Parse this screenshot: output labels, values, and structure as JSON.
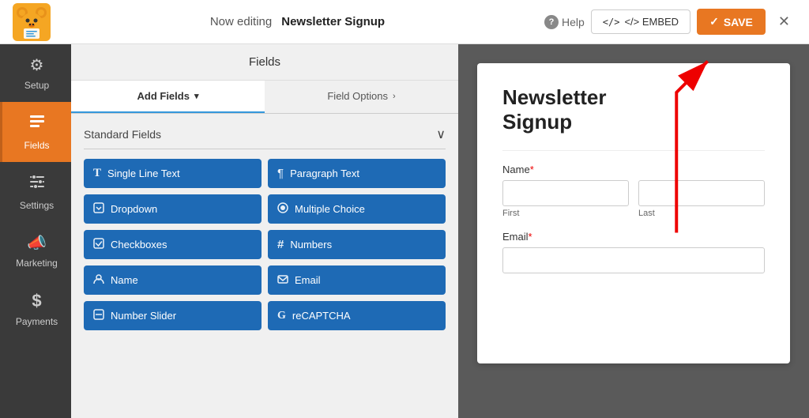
{
  "topbar": {
    "editing_prefix": "Now editing",
    "form_name": "Newsletter Signup",
    "help_label": "Help",
    "embed_label": "</> EMBED",
    "save_label": "✓ SAVE",
    "close_label": "✕"
  },
  "sidebar": {
    "items": [
      {
        "id": "setup",
        "label": "Setup",
        "icon": "⚙"
      },
      {
        "id": "fields",
        "label": "Fields",
        "icon": "▤",
        "active": true
      },
      {
        "id": "settings",
        "label": "Settings",
        "icon": "⚙"
      },
      {
        "id": "marketing",
        "label": "Marketing",
        "icon": "📢"
      },
      {
        "id": "payments",
        "label": "Payments",
        "icon": "$"
      }
    ]
  },
  "fields_panel": {
    "header": "Fields",
    "tabs": [
      {
        "id": "add-fields",
        "label": "Add Fields",
        "active": true,
        "has_arrow": true
      },
      {
        "id": "field-options",
        "label": "Field Options",
        "active": false,
        "has_arrow": true
      }
    ],
    "standard_fields": {
      "section_title": "Standard Fields",
      "buttons": [
        {
          "id": "single-line-text",
          "label": "Single Line Text",
          "icon": "T"
        },
        {
          "id": "paragraph-text",
          "label": "Paragraph Text",
          "icon": "¶"
        },
        {
          "id": "dropdown",
          "label": "Dropdown",
          "icon": "⊟"
        },
        {
          "id": "multiple-choice",
          "label": "Multiple Choice",
          "icon": "⊙"
        },
        {
          "id": "checkboxes",
          "label": "Checkboxes",
          "icon": "☑"
        },
        {
          "id": "numbers",
          "label": "Numbers",
          "icon": "#"
        },
        {
          "id": "name",
          "label": "Name",
          "icon": "👤"
        },
        {
          "id": "email",
          "label": "Email",
          "icon": "✉"
        },
        {
          "id": "number-slider",
          "label": "Number Slider",
          "icon": "⊟"
        },
        {
          "id": "recaptcha",
          "label": "reCAPTCHA",
          "icon": "G"
        }
      ]
    }
  },
  "form_preview": {
    "title_line1": "Newsletter",
    "title_line2": "Signup",
    "fields": [
      {
        "id": "name",
        "label": "Name",
        "required": true,
        "type": "name",
        "subfields": [
          {
            "placeholder": "",
            "sublabel": "First"
          },
          {
            "placeholder": "",
            "sublabel": "Last"
          }
        ]
      },
      {
        "id": "email",
        "label": "Email",
        "required": true,
        "type": "text"
      }
    ]
  },
  "icons": {
    "setup": "⚙",
    "fields": "▤",
    "settings": "≡",
    "marketing": "📣",
    "payments": "$",
    "help_circle": "?",
    "code": "</>",
    "checkmark": "✓",
    "close": "✕",
    "chevron_down": "∨",
    "chevron_right": ">"
  },
  "colors": {
    "accent_orange": "#e87722",
    "accent_blue": "#1e6ab5",
    "sidebar_bg": "#3a3a3a",
    "active_sidebar": "#e87722",
    "preview_bg": "#5a5a5a",
    "red_arrow": "#e00"
  }
}
